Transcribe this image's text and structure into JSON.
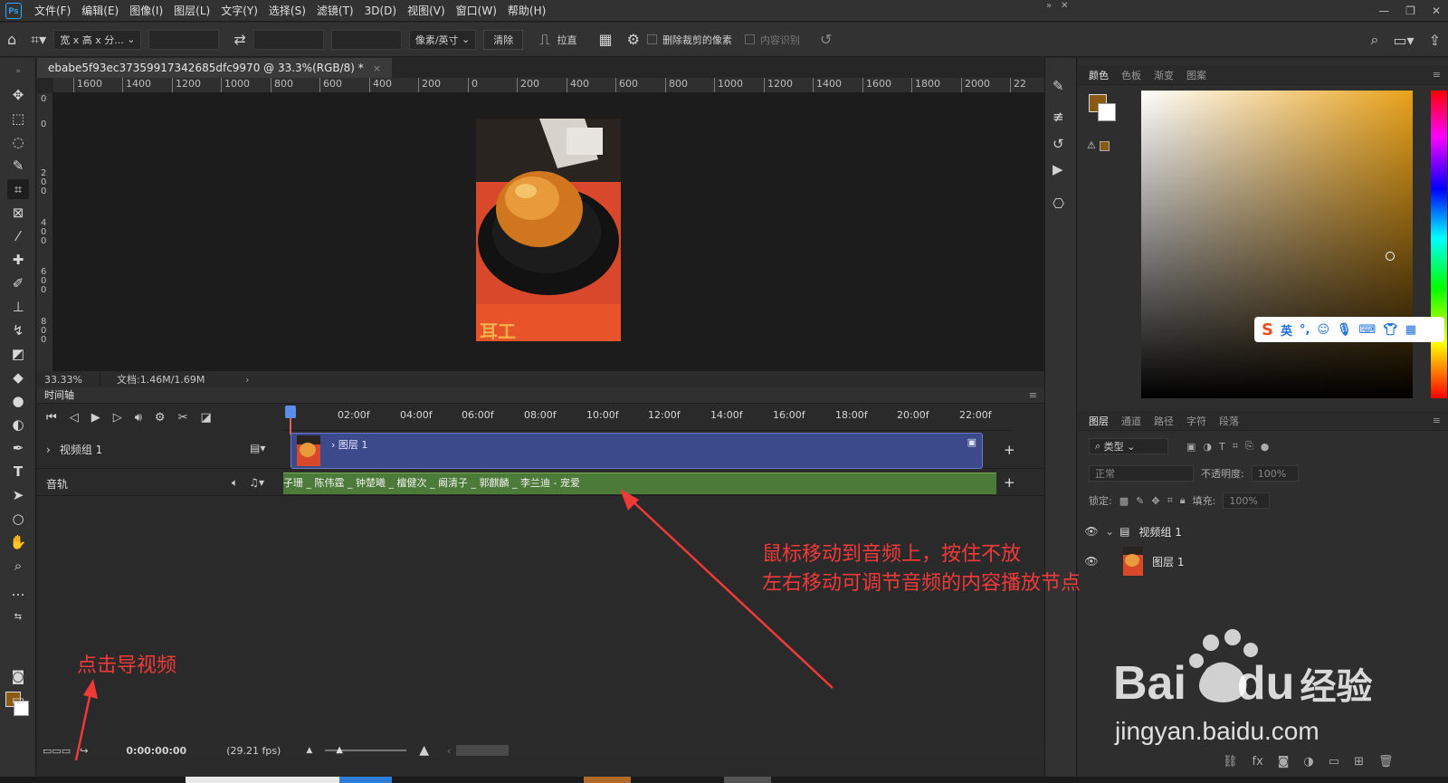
{
  "app": {
    "logo": "Ps"
  },
  "menubar": {
    "items": [
      "文件(F)",
      "编辑(E)",
      "图像(I)",
      "图层(L)",
      "文字(Y)",
      "选择(S)",
      "滤镜(T)",
      "3D(D)",
      "视图(V)",
      "窗口(W)",
      "帮助(H)"
    ]
  },
  "options": {
    "ratio_select": "宽 x 高 x 分...",
    "unit_select": "像素/英寸",
    "clear_button": "清除",
    "straighten": "拉直",
    "delete_cropped": "删除裁剪的像素",
    "content_aware": "内容识别"
  },
  "document": {
    "tab_title": "ebabe5f93ec37359917342685dfc9970 @ 33.3%(RGB/8) *",
    "close": "×",
    "zoom": "33.33%",
    "doc_info": "文档:1.46M/1.69M"
  },
  "ruler_h": [
    "1600",
    "1400",
    "1200",
    "1000",
    "800",
    "600",
    "400",
    "200",
    "0",
    "200",
    "400",
    "600",
    "800",
    "1000",
    "1200",
    "1400",
    "1600",
    "1800",
    "2000",
    "22"
  ],
  "ruler_v": [
    "0",
    "0",
    "200",
    "400",
    "600",
    "800"
  ],
  "timeline": {
    "title": "时间轴",
    "ticks": [
      "02:00f",
      "04:00f",
      "06:00f",
      "08:00f",
      "10:00f",
      "12:00f",
      "14:00f",
      "16:00f",
      "18:00f",
      "20:00f",
      "22:00f"
    ],
    "video_group": "视频组 1",
    "clip_layer": "图层 1",
    "audio_label": "音轨",
    "audio_clip_text": "子珊 _ 陈伟霆 _ 钟楚曦 _ 檀健次 _ 阚清子 _ 郭麒麟 _ 李兰迪 - 宠爱",
    "timecode": "0:00:00:00",
    "fps": "(29.21 fps)"
  },
  "panels": {
    "color_tabs": [
      "颜色",
      "色板",
      "渐变",
      "图案"
    ],
    "layer_tabs": [
      "图层",
      "通道",
      "路径",
      "字符",
      "段落"
    ],
    "kind_filter": "类型",
    "blend_mode": "正常",
    "opacity_label": "不透明度:",
    "opacity_value": "100%",
    "lock_label": "锁定:",
    "fill_label": "填充:",
    "fill_value": "100%",
    "layers": [
      {
        "name": "视频组 1"
      },
      {
        "name": "图层 1"
      }
    ]
  },
  "ime": {
    "lang": "英"
  },
  "annotations": {
    "audio_hint_line1": "鼠标移动到音频上，按住不放",
    "audio_hint_line2": "左右移动可调节音频的内容播放节点",
    "export_hint": "点击导视频"
  },
  "watermark": {
    "brand": "Bai",
    "brand2": "du",
    "cn": "经验",
    "url": "jingyan.baidu.com"
  },
  "colors": {
    "foreground": "#8a5a14",
    "annotation": "#f03a3a",
    "video_clip": "#3c4a8c",
    "audio_clip": "#4c7a38"
  }
}
